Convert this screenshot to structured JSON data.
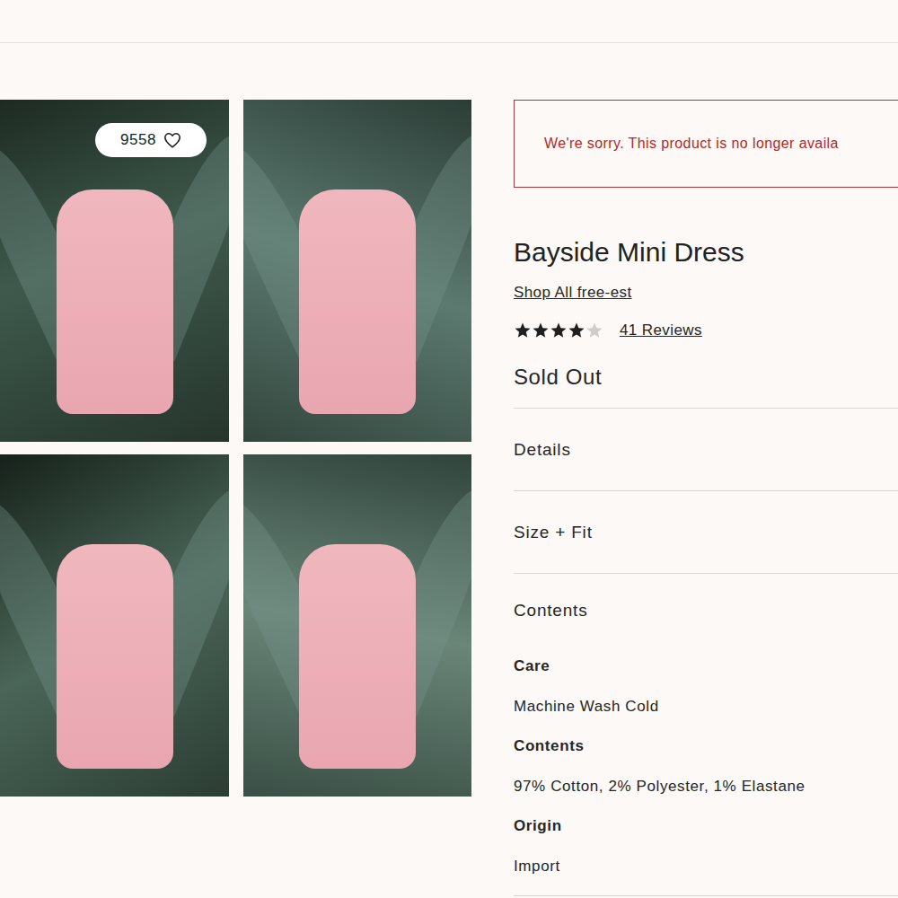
{
  "favorite": {
    "count": "9558"
  },
  "gallery": {
    "photos": 4
  },
  "notice": "We're sorry. This product is no longer availa",
  "product": {
    "title": "Bayside Mini Dress",
    "shop_link": "Shop All free-est",
    "rating": {
      "stars": 4,
      "out_of": 5
    },
    "reviews": "41 Reviews",
    "status": "Sold Out"
  },
  "sections": [
    {
      "label": "Details",
      "expanded": false,
      "fields": []
    },
    {
      "label": "Size + Fit",
      "expanded": false,
      "fields": []
    },
    {
      "label": "Contents",
      "expanded": true,
      "fields": [
        {
          "label": "Care",
          "value": "Machine Wash Cold"
        },
        {
          "label": "Contents",
          "value": "97% Cotton, 2% Polyester, 1% Elastane"
        },
        {
          "label": "Origin",
          "value": "Import"
        }
      ]
    }
  ]
}
